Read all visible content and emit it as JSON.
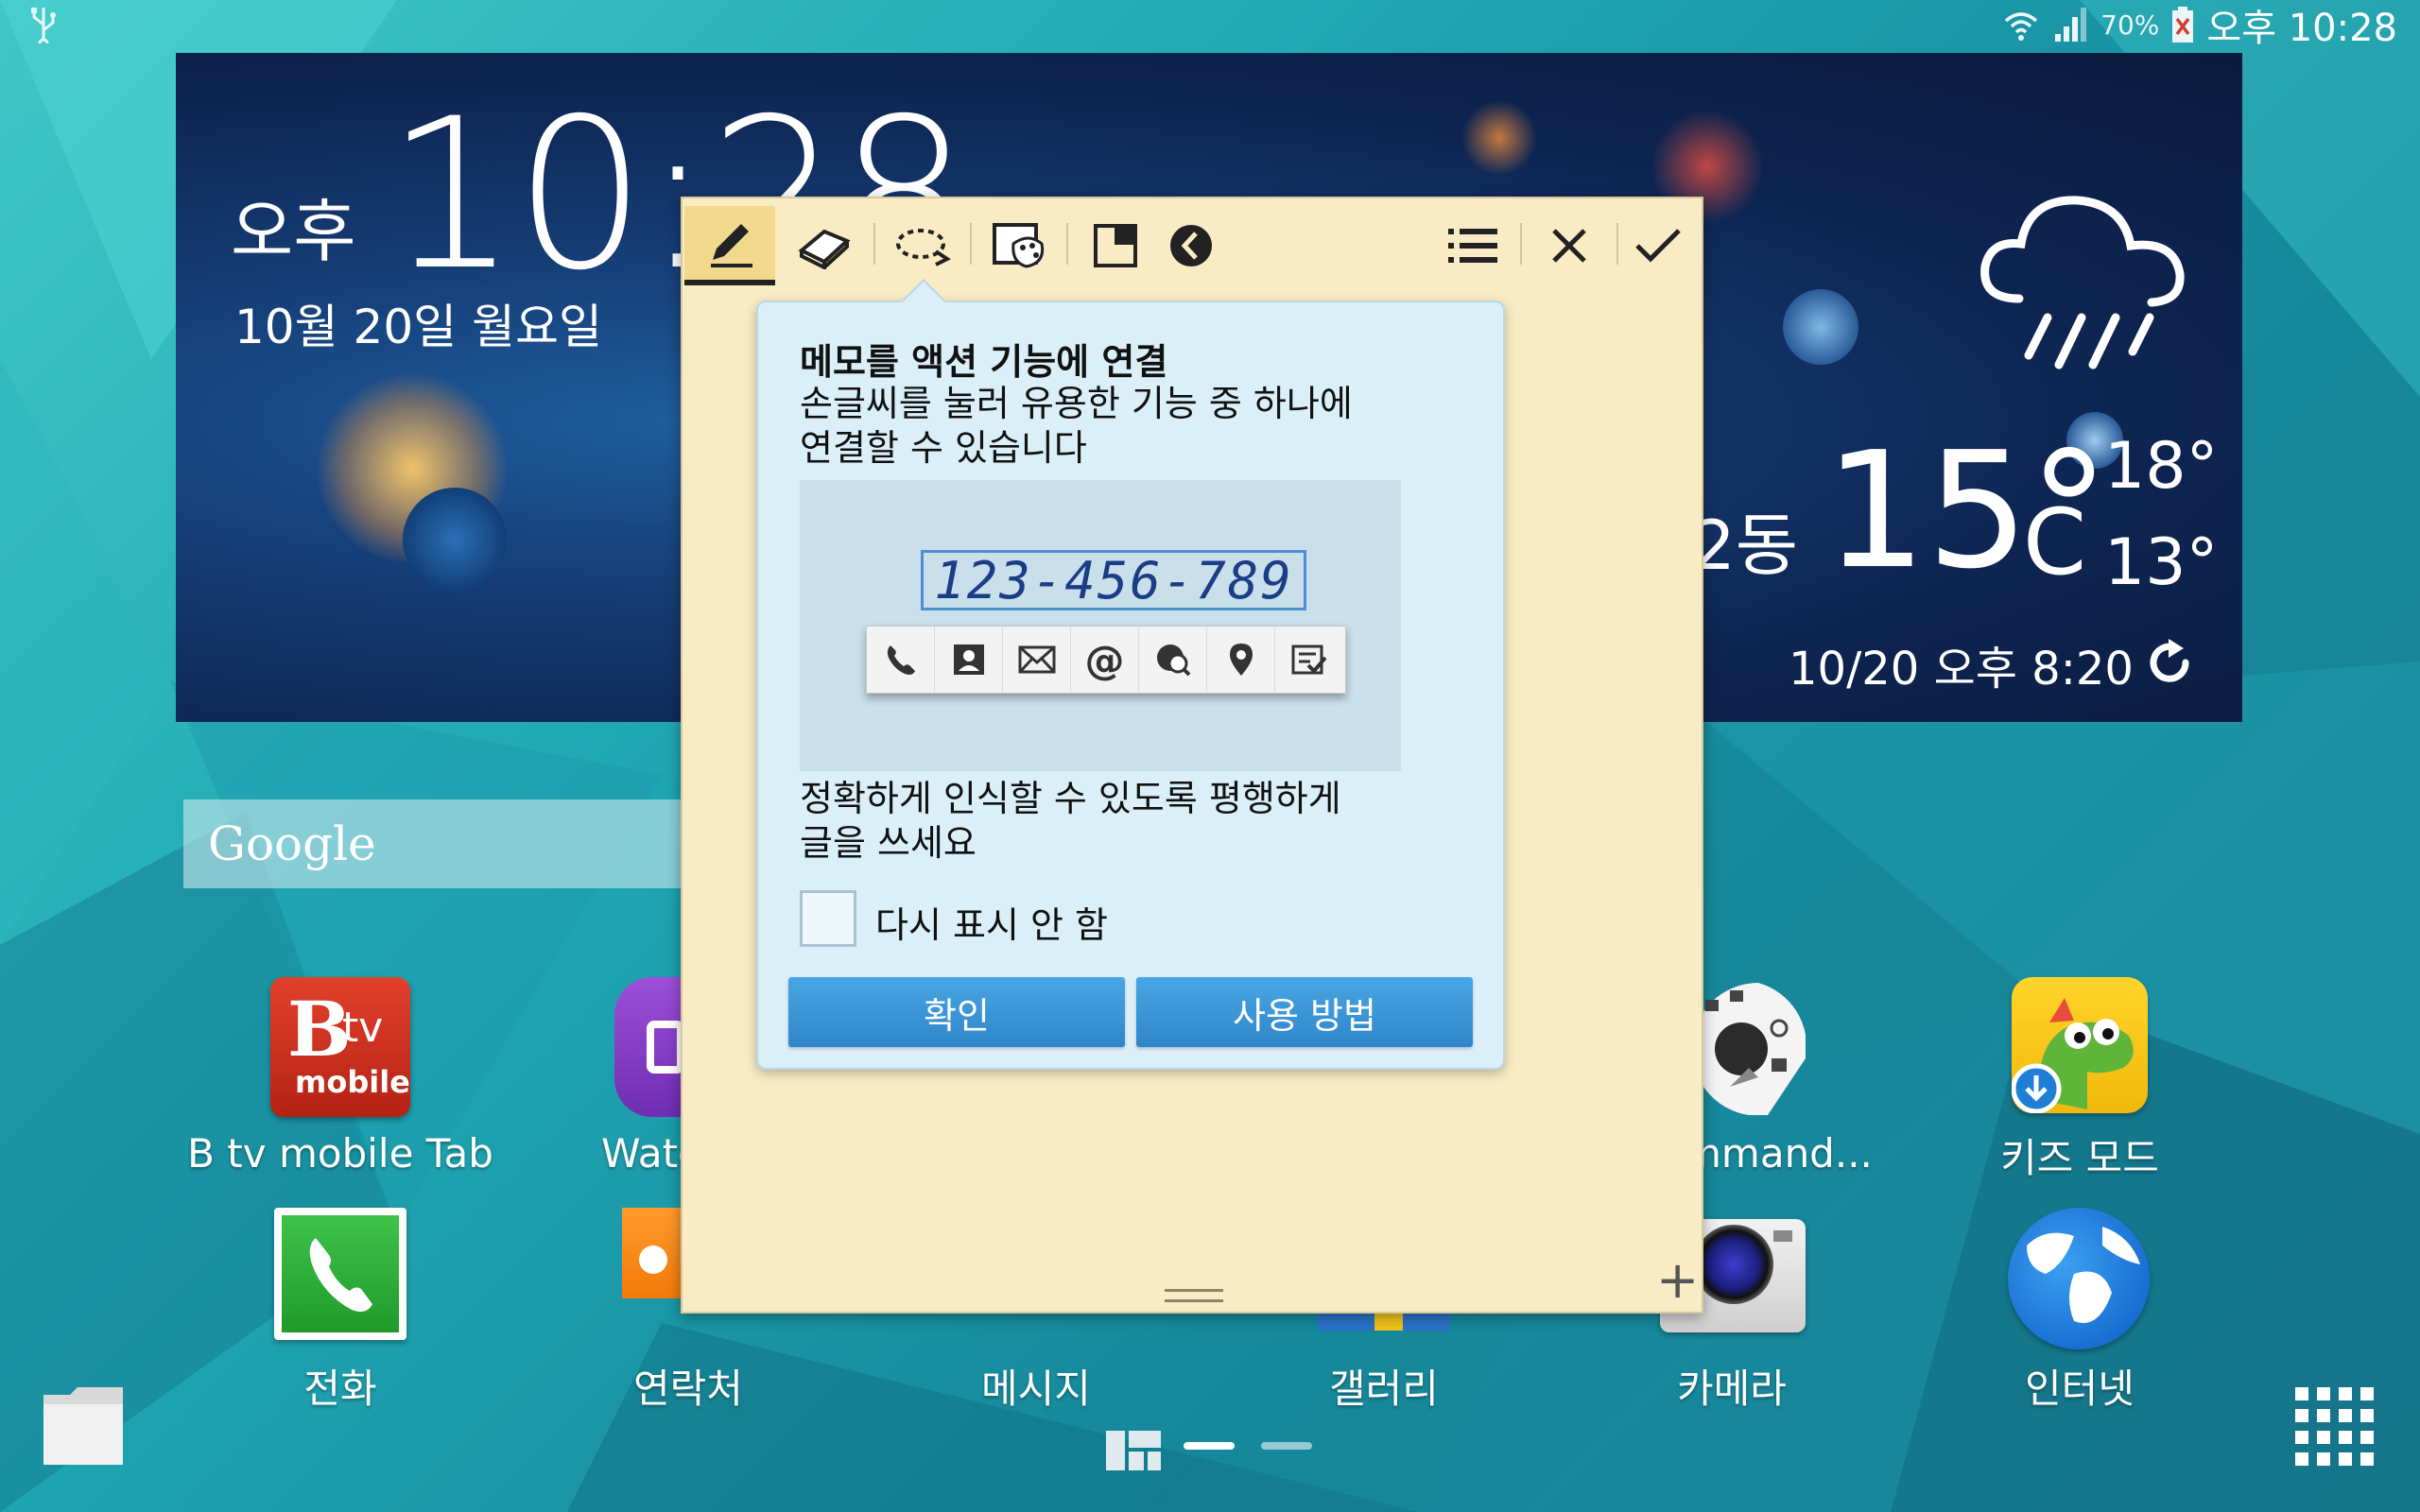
{
  "status": {
    "battery": "70%",
    "time": "오후 10:28"
  },
  "clock": {
    "ampm": "오후",
    "time": "10:28",
    "date": "10월 20일 월요일"
  },
  "weather": {
    "location": "2동",
    "temp": "15°",
    "unit": "C",
    "high": "18°",
    "low": "13°",
    "updated": "10/20 오후 8:20"
  },
  "google": {
    "logo": "Google"
  },
  "apps_row1": [
    {
      "label": "B tv mobile Tab"
    },
    {
      "label": "Watc"
    },
    {
      "label": "mmand..."
    },
    {
      "label": "키즈 모드"
    }
  ],
  "apps_row2": [
    {
      "label": "전화"
    },
    {
      "label": "연락처"
    },
    {
      "label": "메시지"
    },
    {
      "label": "갤러리"
    },
    {
      "label": "카메라"
    },
    {
      "label": "인터넷"
    }
  ],
  "btv_icon": {
    "line1": "tv",
    "line2": "mobile"
  },
  "tooltip": {
    "title": "메모를 액션 기능에 연결",
    "desc_line1": "손글씨를 눌러 유용한 기능 중 하나에",
    "desc_line2": "연결할 수 있습니다",
    "demo_handwriting": "123-456-789",
    "note_line1": "정확하게 인식할 수 있도록 평행하게",
    "note_line2": "글을 쓰세요",
    "checkbox_label": "다시 표시 안 함",
    "ok": "확인",
    "howto": "사용 방법"
  },
  "colors": {
    "bg": "#1fa7b3",
    "memo": "#f9ecc4",
    "tooltip": "#dbeff8",
    "button": "#3a96d8"
  }
}
